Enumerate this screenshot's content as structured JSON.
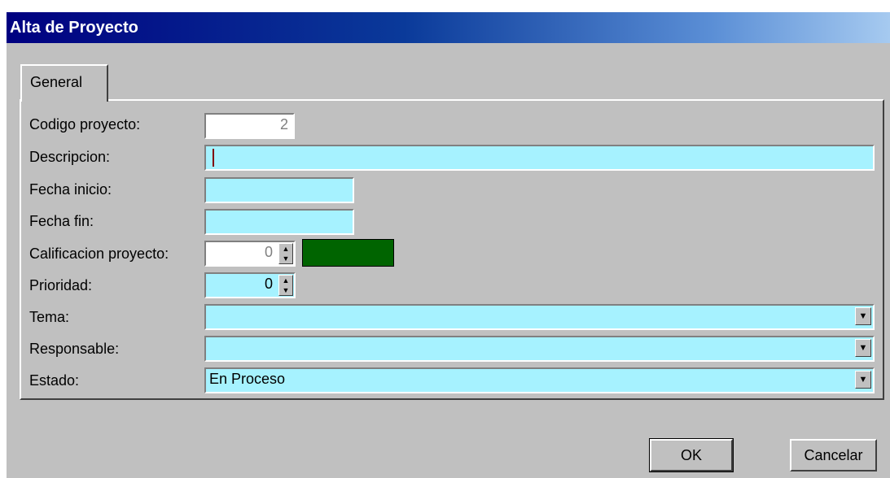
{
  "window": {
    "title": "Alta de Proyecto"
  },
  "tabs": [
    {
      "label": "General"
    }
  ],
  "form": {
    "codigo": {
      "label": "Codigo proyecto:",
      "value": "2"
    },
    "descripcion": {
      "label": "Descripcion:",
      "value": ""
    },
    "fecha_inicio": {
      "label": "Fecha inicio:",
      "value": ""
    },
    "fecha_fin": {
      "label": "Fecha fin:",
      "value": ""
    },
    "calificacion": {
      "label": "Calificacion proyecto:",
      "value": "0",
      "color": "#006400"
    },
    "prioridad": {
      "label": "Prioridad:",
      "value": "0"
    },
    "tema": {
      "label": "Tema:",
      "value": ""
    },
    "responsable": {
      "label": "Responsable:",
      "value": ""
    },
    "estado": {
      "label": "Estado:",
      "value": "En Proceso"
    }
  },
  "buttons": {
    "ok": "OK",
    "cancel": "Cancelar"
  },
  "colors": {
    "field_bg": "#a6f2ff",
    "window_bg": "#c0c0c0",
    "title_bg": "#000080"
  },
  "icons": {
    "spin_up": "▲",
    "spin_down": "▼",
    "dropdown": "▼"
  }
}
